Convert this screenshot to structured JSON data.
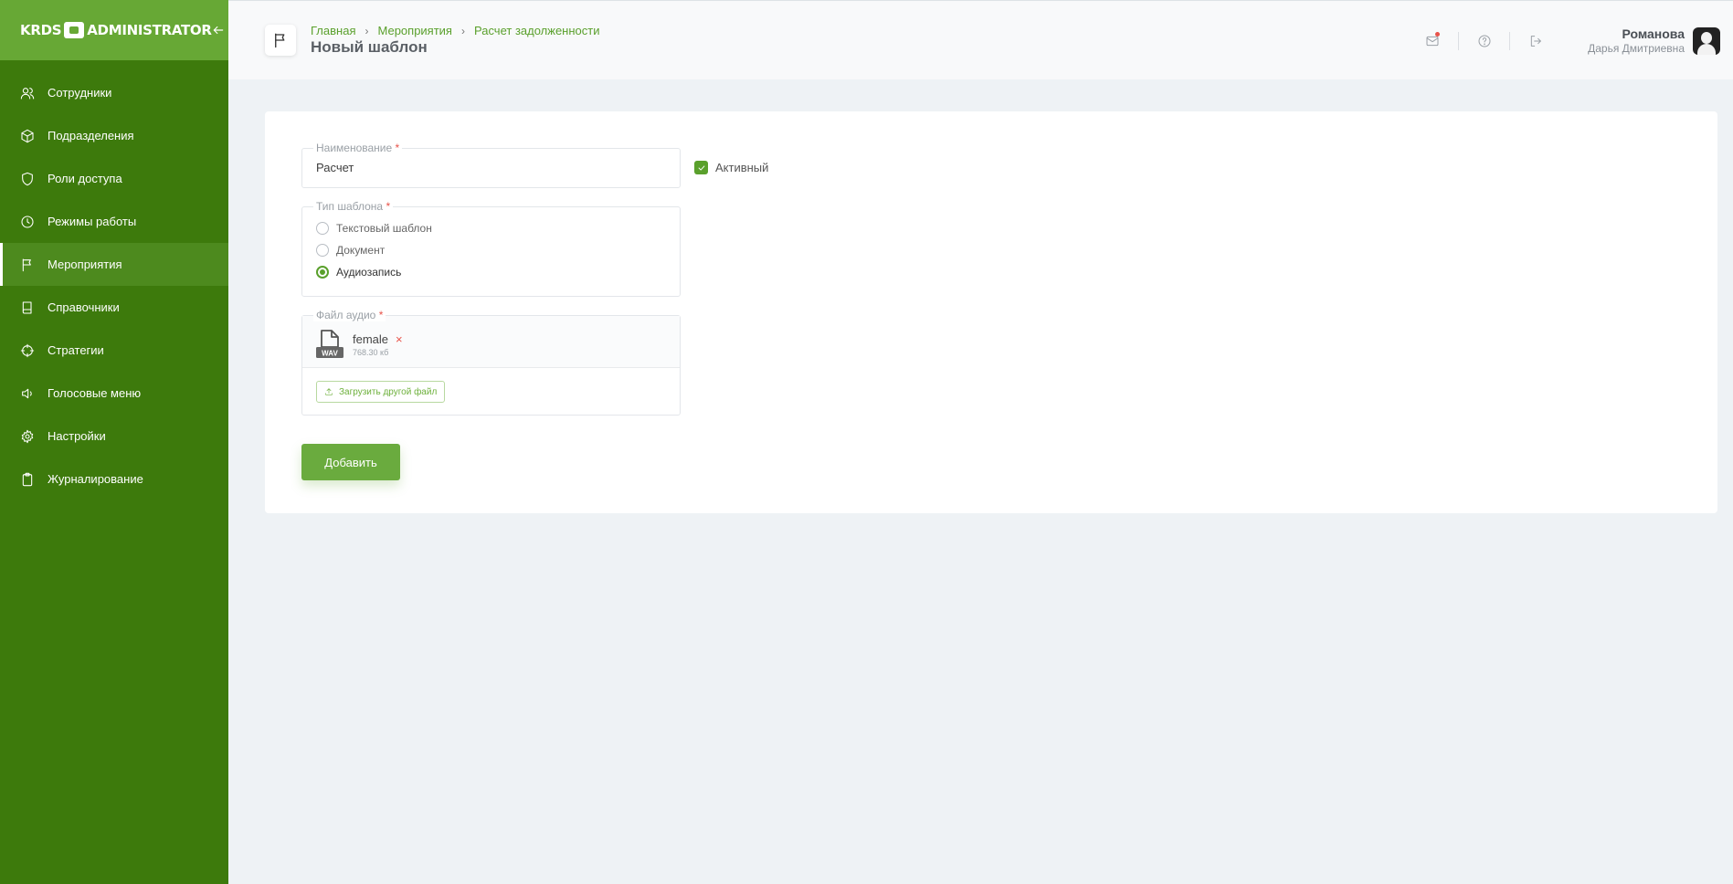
{
  "sidebar": {
    "logo_left": "KRDS",
    "logo_right": "ADMINISTRATOR",
    "items": [
      {
        "label": "Сотрудники",
        "icon": "users-icon"
      },
      {
        "label": "Подразделения",
        "icon": "cube-icon"
      },
      {
        "label": "Роли доступа",
        "icon": "shield-icon"
      },
      {
        "label": "Режимы работы",
        "icon": "clock-icon"
      },
      {
        "label": "Мероприятия",
        "icon": "flag-icon",
        "active": true
      },
      {
        "label": "Справочники",
        "icon": "book-icon"
      },
      {
        "label": "Стратегии",
        "icon": "crosshair-icon"
      },
      {
        "label": "Голосовые меню",
        "icon": "speaker-icon"
      },
      {
        "label": "Настройки",
        "icon": "gear-icon"
      },
      {
        "label": "Журналирование",
        "icon": "clipboard-icon"
      }
    ]
  },
  "header": {
    "breadcrumb": [
      "Главная",
      "Мероприятия",
      "Расчет задолженности"
    ],
    "title": "Новый шаблон",
    "user": {
      "last_name": "Романова",
      "first_name": "Дарья Дмитриевна"
    }
  },
  "form": {
    "name": {
      "label": "Наименование",
      "required": "*",
      "value": "Расчет"
    },
    "active": {
      "label": "Активный",
      "checked": true
    },
    "template_type": {
      "label": "Тип шаблона",
      "required": "*",
      "options": [
        "Текстовый шаблон",
        "Документ",
        "Аудиозапись"
      ],
      "selected": "Аудиозапись"
    },
    "audio_file": {
      "label": "Файл аудио",
      "required": "*",
      "file_name": "female",
      "remove": "×",
      "file_ext": "WAV",
      "file_size": "768.30 кб",
      "upload_label": "Загрузить другой файл"
    },
    "submit_label": "Добавить"
  },
  "colors": {
    "sidebar": "#3d7a0c",
    "sidebar_head": "#67a835",
    "accent": "#5aa02c",
    "danger": "#e8534a"
  }
}
